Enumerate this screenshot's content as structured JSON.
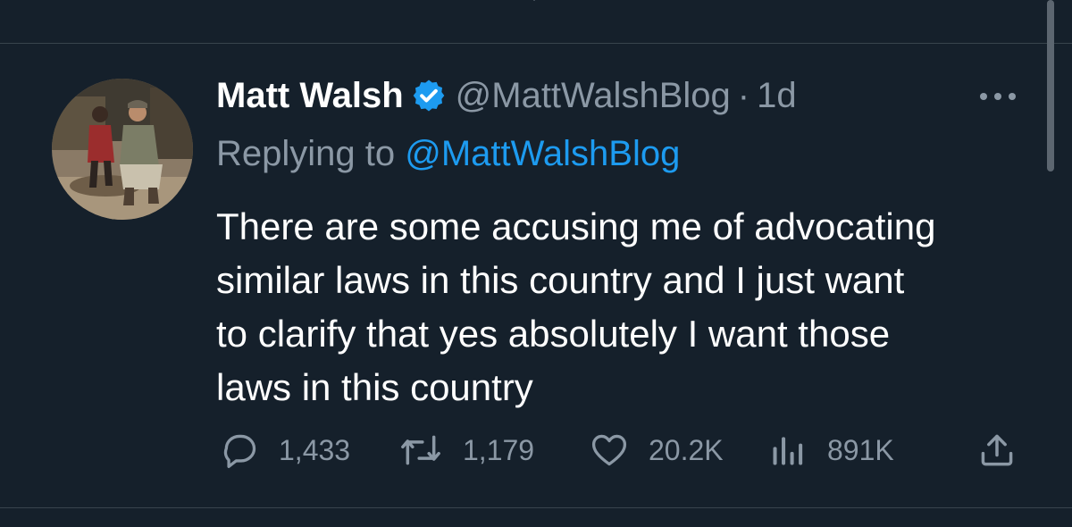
{
  "tweet": {
    "author_name": "Matt Walsh",
    "handle": "@MattWalshBlog",
    "separator": "·",
    "timestamp": "1d",
    "replying_prefix": "Replying to",
    "replying_to": "@MattWalshBlog",
    "text_lines": [
      "There are some accusing me of advocating",
      "similar laws in this country and I just want",
      "to clarify that yes absolutely I want those",
      "laws in this country"
    ],
    "verified": true
  },
  "actions": {
    "replies": "1,433",
    "retweets": "1,179",
    "likes": "20.2K",
    "views": "891K"
  },
  "colors": {
    "background": "#15202b",
    "text_primary": "#ffffff",
    "text_secondary": "#8b98a5",
    "accent": "#1d9bf0",
    "divider": "#38444d"
  },
  "icons": {
    "verified": "verified-badge-icon",
    "more": "more-horizontal-icon",
    "reply": "reply-icon",
    "retweet": "retweet-icon",
    "like": "heart-icon",
    "views": "analytics-icon",
    "share": "share-icon"
  }
}
